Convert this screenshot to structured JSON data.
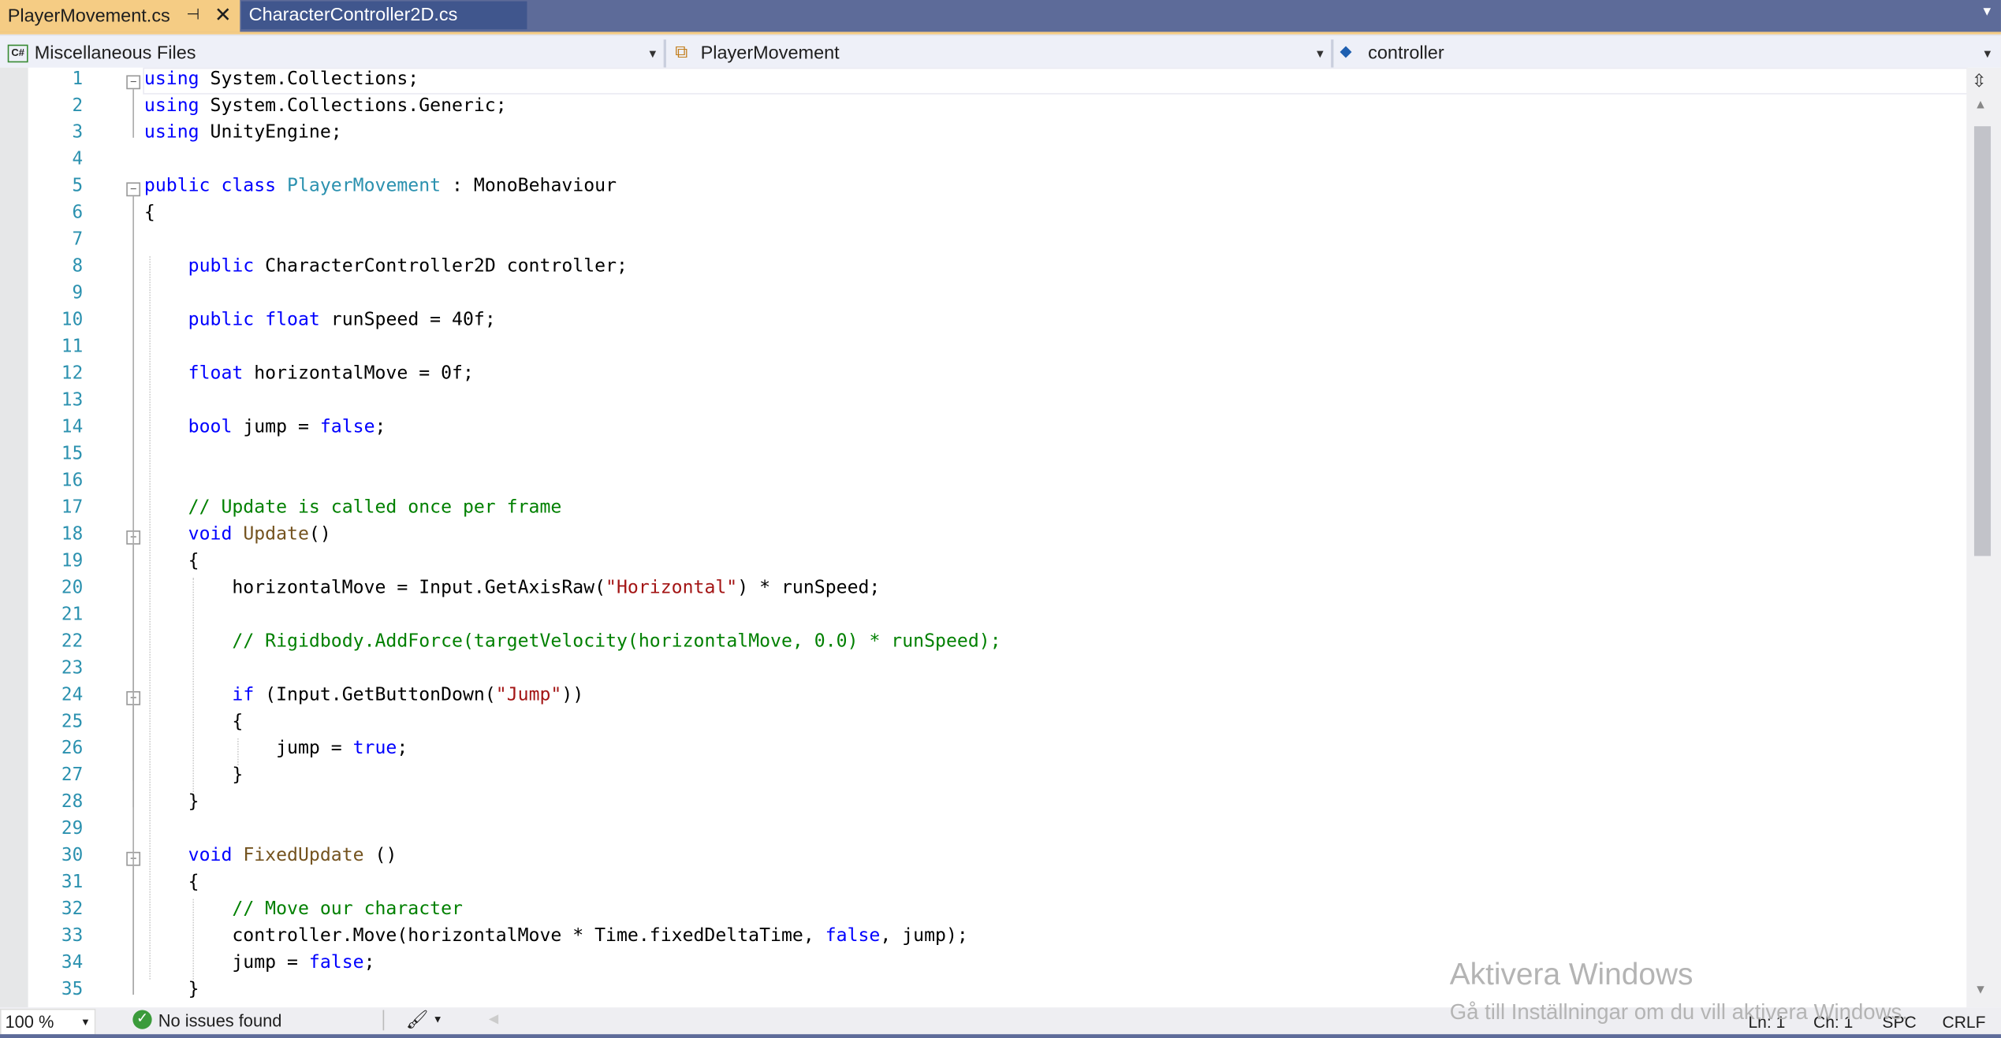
{
  "tabs": [
    {
      "label": "PlayerMovement.cs",
      "active": true
    },
    {
      "label": "CharacterController2D.cs",
      "active": false
    }
  ],
  "nav": {
    "project": "Miscellaneous Files",
    "class": "PlayerMovement",
    "member": "controller"
  },
  "colors": {
    "keyword": "#0000ff",
    "type": "#2b91af",
    "method": "#74531f",
    "string": "#a31515",
    "comment": "#008000",
    "tab_active": "#f5cc84",
    "tab_bar": "#5d6b99"
  },
  "code_lines": [
    [
      [
        "k",
        "using"
      ],
      [
        "p",
        " System.Collections;"
      ]
    ],
    [
      [
        "k",
        "using"
      ],
      [
        "p",
        " System.Collections.Generic;"
      ]
    ],
    [
      [
        "k",
        "using"
      ],
      [
        "p",
        " UnityEngine;"
      ]
    ],
    [],
    [
      [
        "k",
        "public"
      ],
      [
        "p",
        " "
      ],
      [
        "k",
        "class"
      ],
      [
        "p",
        " "
      ],
      [
        "ty",
        "PlayerMovement"
      ],
      [
        "p",
        " : MonoBehaviour"
      ]
    ],
    [
      [
        "p",
        "{"
      ]
    ],
    [],
    [
      [
        "p",
        "    "
      ],
      [
        "k",
        "public"
      ],
      [
        "p",
        " CharacterController2D controller;"
      ]
    ],
    [],
    [
      [
        "p",
        "    "
      ],
      [
        "k",
        "public"
      ],
      [
        "p",
        " "
      ],
      [
        "k",
        "float"
      ],
      [
        "p",
        " runSpeed = 40f;"
      ]
    ],
    [],
    [
      [
        "p",
        "    "
      ],
      [
        "k",
        "float"
      ],
      [
        "p",
        " horizontalMove = 0f;"
      ]
    ],
    [],
    [
      [
        "p",
        "    "
      ],
      [
        "k",
        "bool"
      ],
      [
        "p",
        " jump = "
      ],
      [
        "k",
        "false"
      ],
      [
        "p",
        ";"
      ]
    ],
    [],
    [],
    [
      [
        "p",
        "    "
      ],
      [
        "c",
        "// Update is called once per frame"
      ]
    ],
    [
      [
        "p",
        "    "
      ],
      [
        "k",
        "void"
      ],
      [
        "p",
        " "
      ],
      [
        "m",
        "Update"
      ],
      [
        "p",
        "()"
      ]
    ],
    [
      [
        "p",
        "    {"
      ]
    ],
    [
      [
        "p",
        "        horizontalMove = Input.GetAxisRaw("
      ],
      [
        "s",
        "\"Horizontal\""
      ],
      [
        "p",
        ") * runSpeed;"
      ]
    ],
    [],
    [
      [
        "p",
        "        "
      ],
      [
        "c",
        "// Rigidbody.AddForce(targetVelocity(horizontalMove, 0.0) * runSpeed);"
      ]
    ],
    [],
    [
      [
        "p",
        "        "
      ],
      [
        "k",
        "if"
      ],
      [
        "p",
        " (Input.GetButtonDown("
      ],
      [
        "s",
        "\"Jump\""
      ],
      [
        "p",
        "))"
      ]
    ],
    [
      [
        "p",
        "        {"
      ]
    ],
    [
      [
        "p",
        "            jump = "
      ],
      [
        "k",
        "true"
      ],
      [
        "p",
        ";"
      ]
    ],
    [
      [
        "p",
        "        }"
      ]
    ],
    [
      [
        "p",
        "    }"
      ]
    ],
    [],
    [
      [
        "p",
        "    "
      ],
      [
        "k",
        "void"
      ],
      [
        "p",
        " "
      ],
      [
        "m",
        "FixedUpdate"
      ],
      [
        "p",
        " ()"
      ]
    ],
    [
      [
        "p",
        "    {"
      ]
    ],
    [
      [
        "p",
        "        "
      ],
      [
        "c",
        "// Move our character"
      ]
    ],
    [
      [
        "p",
        "        controller.Move(horizontalMove * Time.fixedDeltaTime, "
      ],
      [
        "k",
        "false"
      ],
      [
        "p",
        ", jump);"
      ]
    ],
    [
      [
        "p",
        "        jump = "
      ],
      [
        "k",
        "false"
      ],
      [
        "p",
        ";"
      ]
    ],
    [
      [
        "p",
        "    }"
      ]
    ]
  ],
  "fold_lines": [
    1,
    5,
    18,
    24,
    30
  ],
  "status": {
    "zoom": "100 %",
    "issues": "No issues found",
    "ln": "Ln: 1",
    "ch": "Ch: 1",
    "spc": "SPC",
    "crlf": "CRLF"
  },
  "watermark": {
    "title": "Aktivera Windows",
    "subtitle": "Gå till Inställningar om du vill aktivera Windows."
  }
}
